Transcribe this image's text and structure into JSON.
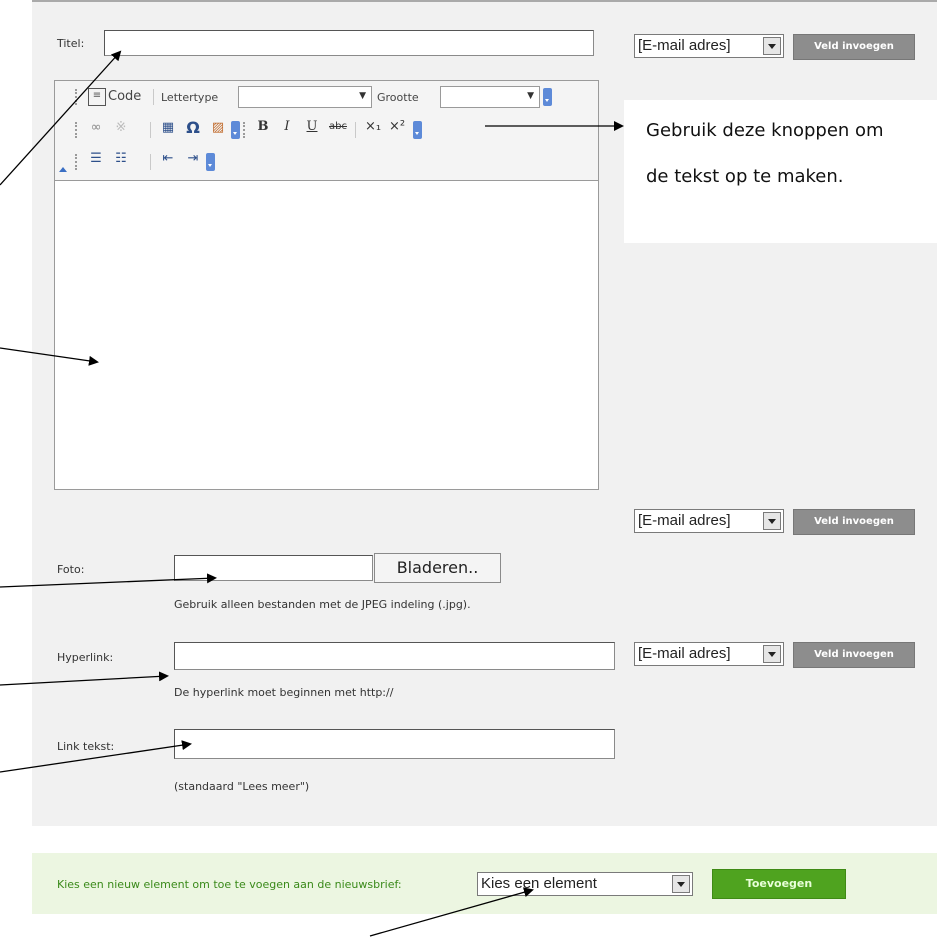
{
  "form": {
    "titel_label": "Titel:",
    "foto_label": "Foto:",
    "browse_button": "Bladeren..",
    "foto_hint": "Gebruik alleen bestanden met de JPEG indeling (.jpg).",
    "hyperlink_label": "Hyperlink:",
    "hyperlink_hint": "De hyperlink moet beginnen met http://",
    "linktekst_label": "Link tekst:",
    "linktekst_hint": "(standaard \"Lees meer\")"
  },
  "editor": {
    "code_label": "Code",
    "font_label": "Lettertype",
    "size_label": "Grootte"
  },
  "field_insert": {
    "select_value": "[E-mail adres]",
    "button_label": "Veld invoegen"
  },
  "callout": {
    "line1": "Gebruik deze knoppen om",
    "line2": "de tekst op te maken."
  },
  "footer": {
    "prompt": "Kies een nieuw element om toe te voegen aan de nieuwsbrief:",
    "select_value": "Kies een element",
    "add_button": "Toevoegen"
  },
  "colors": {
    "panel_bg": "#f1f1f1",
    "footer_bg": "#ecf6e1",
    "add_button": "#4fa31f",
    "insert_button": "#8d8d8d"
  }
}
